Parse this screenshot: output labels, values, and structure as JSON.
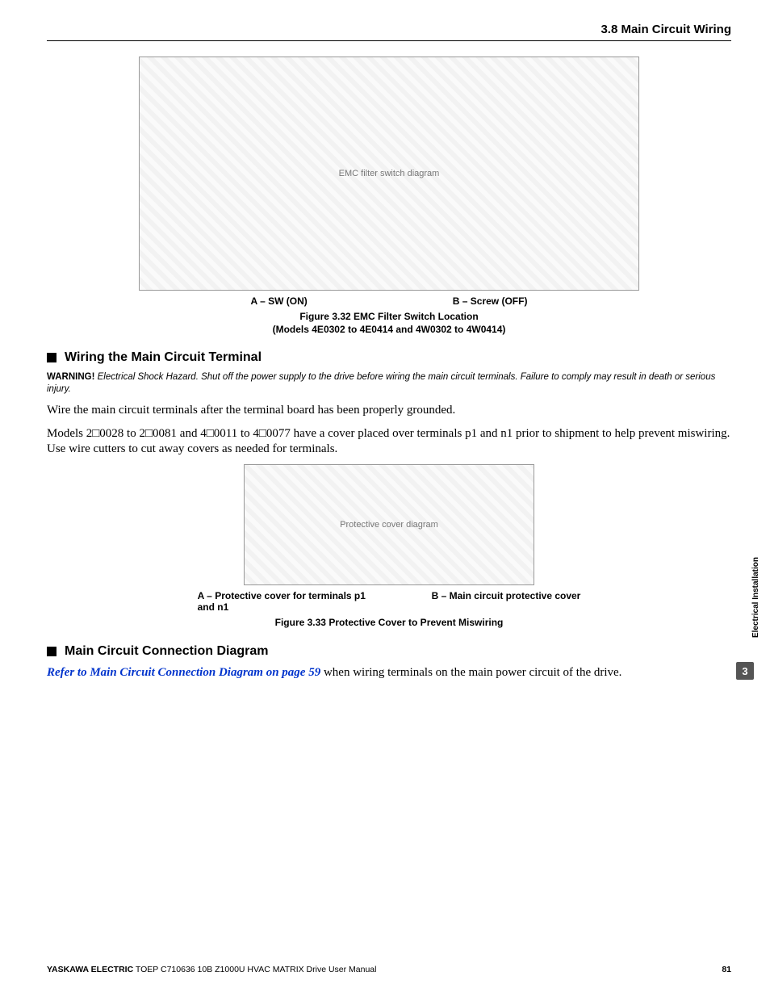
{
  "header": {
    "section": "3.8 Main Circuit Wiring"
  },
  "figure1": {
    "placeholder": "EMC filter switch diagram",
    "legendA": "A – SW (ON)",
    "legendB": "B – Screw (OFF)",
    "caption1": "Figure 3.32  EMC Filter Switch Location",
    "caption2": "(Models 4E0302 to 4E0414 and 4W0302 to 4W0414)"
  },
  "sub1": {
    "title": "Wiring the Main Circuit Terminal"
  },
  "warning": {
    "label": "WARNING!",
    "text": " Electrical Shock Hazard. Shut off the power supply to the drive before wiring the main circuit terminals. Failure to comply may result in death or serious injury."
  },
  "para1": "Wire the main circuit terminals after the terminal board has been properly grounded.",
  "para2": "Models 2□0028 to 2□0081 and 4□0011 to 4□0077 have a cover placed over terminals p1 and n1 prior to shipment to help prevent miswiring. Use wire cutters to cut away covers as needed for terminals.",
  "figure2": {
    "placeholder": "Protective cover diagram",
    "legendA": "A – Protective cover for terminals p1 and n1",
    "legendB": "B – Main circuit protective cover",
    "caption": "Figure 3.33  Protective Cover to Prevent Miswiring"
  },
  "sub2": {
    "title": "Main Circuit Connection Diagram"
  },
  "para3": {
    "link": "Refer to Main Circuit Connection Diagram on page 59",
    "rest": " when wiring terminals on the main power circuit of the drive."
  },
  "side": {
    "chapter": "3",
    "label": "Electrical Installation"
  },
  "footer": {
    "company": "YASKAWA ELECTRIC",
    "doc": " TOEP C710636 10B Z1000U HVAC MATRIX Drive User Manual",
    "page": "81"
  }
}
